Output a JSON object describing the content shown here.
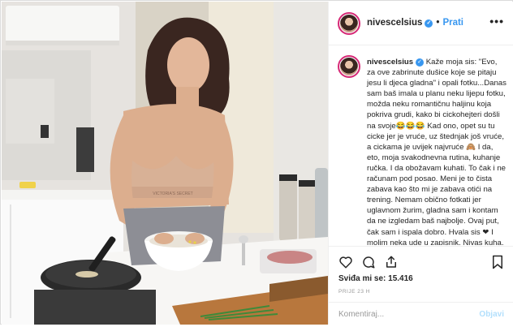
{
  "post": {
    "username": "nivescelsius",
    "follow_label": "Prati",
    "more_label": "•••",
    "caption_user": "nivescelsius",
    "caption_text": "Kaže moja sis: \"Evo, za ove zabrinute dušice koje se pitaju jesu li djeca gladna\" i opali fotku...Danas sam baš imala u planu neku lijepu fotku, možda neku romantičnu haljinu koja pokriva grudi, kako bi cickohejteri došli na svoje😂😂😂 Kad ono, opet su tu cicke jer je vruće, uz štednjak još vruće, a cickama je uvijek najvruće 🙈 I da, eto, moja svakodnevna rutina, kuhanje ručka. I da obožavam kuhati. To čak i ne računam pod posao. Meni je to čista zabava kao što mi je zabava otići na trening. Nemam obično fotkati jer uglavnom žurim, gladna sam i kontam da ne izgledam baš najbolje. Ovaj put, čak sam i ispala dobro. Hvala sis ❤ I molim neka ude u zapisnik. Nivas kuha. I to nanriličnn dobro",
    "likes_label": "Sviđa mi se: 15.416",
    "time_label": "PRIJE 23 H",
    "comment_placeholder": "Komentiraj...",
    "post_button": "Objavi"
  },
  "photo": {
    "apron_text": "VICTORIA'S SECRET"
  },
  "colors": {
    "link": "#3897f0",
    "text": "#262626",
    "muted": "#999999",
    "border": "#dbdbdb"
  },
  "icons": [
    "verified-icon",
    "heart-icon",
    "comment-icon",
    "share-icon",
    "save-icon",
    "more-icon"
  ]
}
